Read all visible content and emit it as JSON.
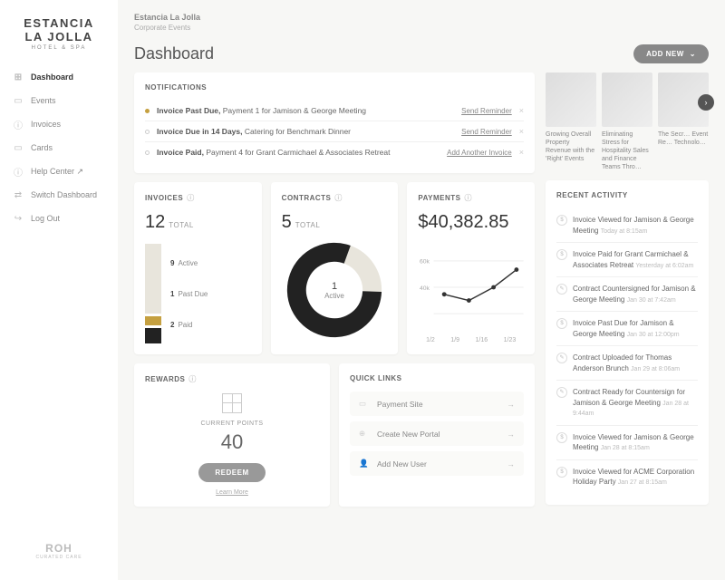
{
  "brand": {
    "l1": "ESTANCIA",
    "l2": "LA JOLLA",
    "l3": "HOTEL & SPA"
  },
  "crumb": {
    "title": "Estancia La Jolla",
    "sub": "Corporate Events"
  },
  "page_title": "Dashboard",
  "add_btn": "ADD NEW",
  "nav": [
    {
      "icon": "⊞",
      "label": "Dashboard",
      "active": true
    },
    {
      "icon": "▭",
      "label": "Events"
    },
    {
      "icon": "ⓘ",
      "label": "Invoices"
    },
    {
      "icon": "▭",
      "label": "Cards"
    },
    {
      "icon": "ⓘ",
      "label": "Help Center ↗"
    },
    {
      "icon": "⇄",
      "label": "Switch Dashboard"
    },
    {
      "icon": "↪",
      "label": "Log Out"
    }
  ],
  "footer": {
    "name": "ROH",
    "sub": "CURATED CARE"
  },
  "notifications": {
    "title": "NOTIFICATIONS",
    "rows": [
      {
        "dot": "amber",
        "b": "Invoice Past Due,",
        "t": " Payment 1 for Jamison & George Meeting",
        "act": "Send Reminder"
      },
      {
        "dot": "grey",
        "b": "Invoice Due in 14 Days,",
        "t": " Catering for Benchmark Dinner",
        "act": "Send Reminder"
      },
      {
        "dot": "grey",
        "b": "Invoice Paid,",
        "t": " Payment 4 for Grant Carmichael & Associates Retreat",
        "act": "Add Another Invoice"
      }
    ]
  },
  "invoices": {
    "title": "INVOICES",
    "count": "12",
    "unit": "TOTAL",
    "legend": [
      {
        "n": "9",
        "l": "Active"
      },
      {
        "n": "1",
        "l": "Past Due"
      },
      {
        "n": "2",
        "l": "Paid"
      }
    ]
  },
  "contracts": {
    "title": "CONTRACTS",
    "count": "5",
    "unit": "TOTAL",
    "center_n": "1",
    "center_l": "Active"
  },
  "payments": {
    "title": "PAYMENTS",
    "amount": "$40,382.85",
    "xlabels": [
      "1/2",
      "1/9",
      "1/16",
      "1/23"
    ]
  },
  "chart_data": {
    "type": "line",
    "x": [
      "1/2",
      "1/9",
      "1/16",
      "1/23"
    ],
    "values": [
      32000,
      27000,
      40000,
      55000
    ],
    "ylim": [
      0,
      60000
    ],
    "yticks": [
      "60k",
      "40k"
    ]
  },
  "rewards": {
    "title": "REWARDS",
    "label": "CURRENT POINTS",
    "points": "40",
    "btn": "REDEEM",
    "learn": "Learn More"
  },
  "quicklinks": {
    "title": "QUICK LINKS",
    "items": [
      {
        "icon": "▭",
        "label": "Payment Site"
      },
      {
        "icon": "⊕",
        "label": "Create New Portal"
      },
      {
        "icon": "👤",
        "label": "Add New User"
      }
    ]
  },
  "carousel": [
    {
      "cap": "Growing Overall Property Revenue with the 'Right' Events"
    },
    {
      "cap": "Eliminating Stress for Hospitality Sales and Finance Teams Thro…"
    },
    {
      "cap": "The Secr… Event Re… Technolo…"
    }
  ],
  "activity": {
    "title": "RECENT ACTIVITY",
    "rows": [
      {
        "ic": "$",
        "t": "Invoice Viewed for Jamison & George Meeting",
        "ts": "Today at 8:15am"
      },
      {
        "ic": "$",
        "t": "Invoice Paid for Grant Carmichael & Associates Retreat",
        "ts": "Yesterday at 6:02am"
      },
      {
        "ic": "✎",
        "t": "Contract Countersigned for Jamison & George Meeting",
        "ts": "Jan 30 at 7:42am"
      },
      {
        "ic": "$",
        "t": "Invoice Past Due for Jamison & George Meeting",
        "ts": "Jan 30 at 12:00pm"
      },
      {
        "ic": "✎",
        "t": "Contract Uploaded for Thomas Anderson Brunch",
        "ts": "Jan 29 at 8:06am"
      },
      {
        "ic": "✎",
        "t": "Contract Ready for Countersign for Jamison & George Meeting",
        "ts": "Jan 28 at 9:44am"
      },
      {
        "ic": "$",
        "t": "Invoice Viewed for Jamison & George Meeting",
        "ts": "Jan 28 at 8:15am"
      },
      {
        "ic": "$",
        "t": "Invoice Viewed for ACME Corporation Holiday Party",
        "ts": "Jan 27 at 8:15am"
      }
    ]
  }
}
